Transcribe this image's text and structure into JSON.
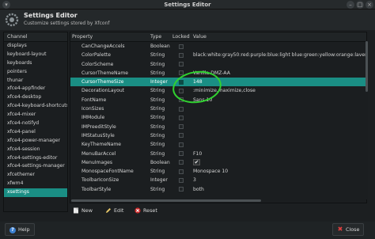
{
  "window": {
    "title": "Settings Editor"
  },
  "header": {
    "title": "Settings Editor",
    "subtitle": "Customize settings stored by Xfconf"
  },
  "channels": {
    "header": "Channel",
    "items": [
      "displays",
      "keyboard-layout",
      "keyboards",
      "pointers",
      "thunar",
      "xfce4-appfinder",
      "xfce4-desktop",
      "xfce4-keyboard-shortcuts",
      "xfce4-mixer",
      "xfce4-notifyd",
      "xfce4-panel",
      "xfce4-power-manager",
      "xfce4-session",
      "xfce4-settings-editor",
      "xfce4-settings-manager",
      "xfcethemer",
      "xfwm4",
      "xsettings"
    ],
    "selected": "xsettings"
  },
  "properties": {
    "columns": {
      "property": "Property",
      "type": "Type",
      "locked": "Locked",
      "value": "Value"
    },
    "rows": [
      {
        "name": "CanChangeAccels",
        "type": "Boolean",
        "value": ""
      },
      {
        "name": "ColorPalette",
        "type": "String",
        "value": "black:white:gray50:red:purple:blue:light blue:green:yellow:orange:lavender:"
      },
      {
        "name": "ColorScheme",
        "type": "String",
        "value": ""
      },
      {
        "name": "CursorThemeName",
        "type": "String",
        "value": "Vanilla-DMZ-AA"
      },
      {
        "name": "CursorThemeSize",
        "type": "Integer",
        "value": "148",
        "selected": true
      },
      {
        "name": "DecorationLayout",
        "type": "String",
        "value": ":minimize,maximize,close"
      },
      {
        "name": "FontName",
        "type": "String",
        "value": "Sans 10"
      },
      {
        "name": "IconSizes",
        "type": "String",
        "value": ""
      },
      {
        "name": "IMModule",
        "type": "String",
        "value": ""
      },
      {
        "name": "IMPreeditStyle",
        "type": "String",
        "value": ""
      },
      {
        "name": "IMStatusStyle",
        "type": "String",
        "value": ""
      },
      {
        "name": "KeyThemeName",
        "type": "String",
        "value": ""
      },
      {
        "name": "MenuBarAccel",
        "type": "String",
        "value": "F10"
      },
      {
        "name": "MenuImages",
        "type": "Boolean",
        "value": "✔"
      },
      {
        "name": "MonospaceFontName",
        "type": "String",
        "value": "Monospace 10"
      },
      {
        "name": "ToolbarIconSize",
        "type": "Integer",
        "value": "3"
      },
      {
        "name": "ToolbarStyle",
        "type": "String",
        "value": "both"
      }
    ]
  },
  "edit_buttons": {
    "new": "New",
    "edit": "Edit",
    "reset": "Reset"
  },
  "footer": {
    "help": "Help",
    "close": "Close"
  },
  "colors": {
    "selection": "#1a8e84",
    "annotation": "#30d130"
  },
  "icons": [
    "settings-editor-icon",
    "new-icon",
    "edit-icon",
    "reset-icon",
    "help-icon",
    "close-icon"
  ]
}
